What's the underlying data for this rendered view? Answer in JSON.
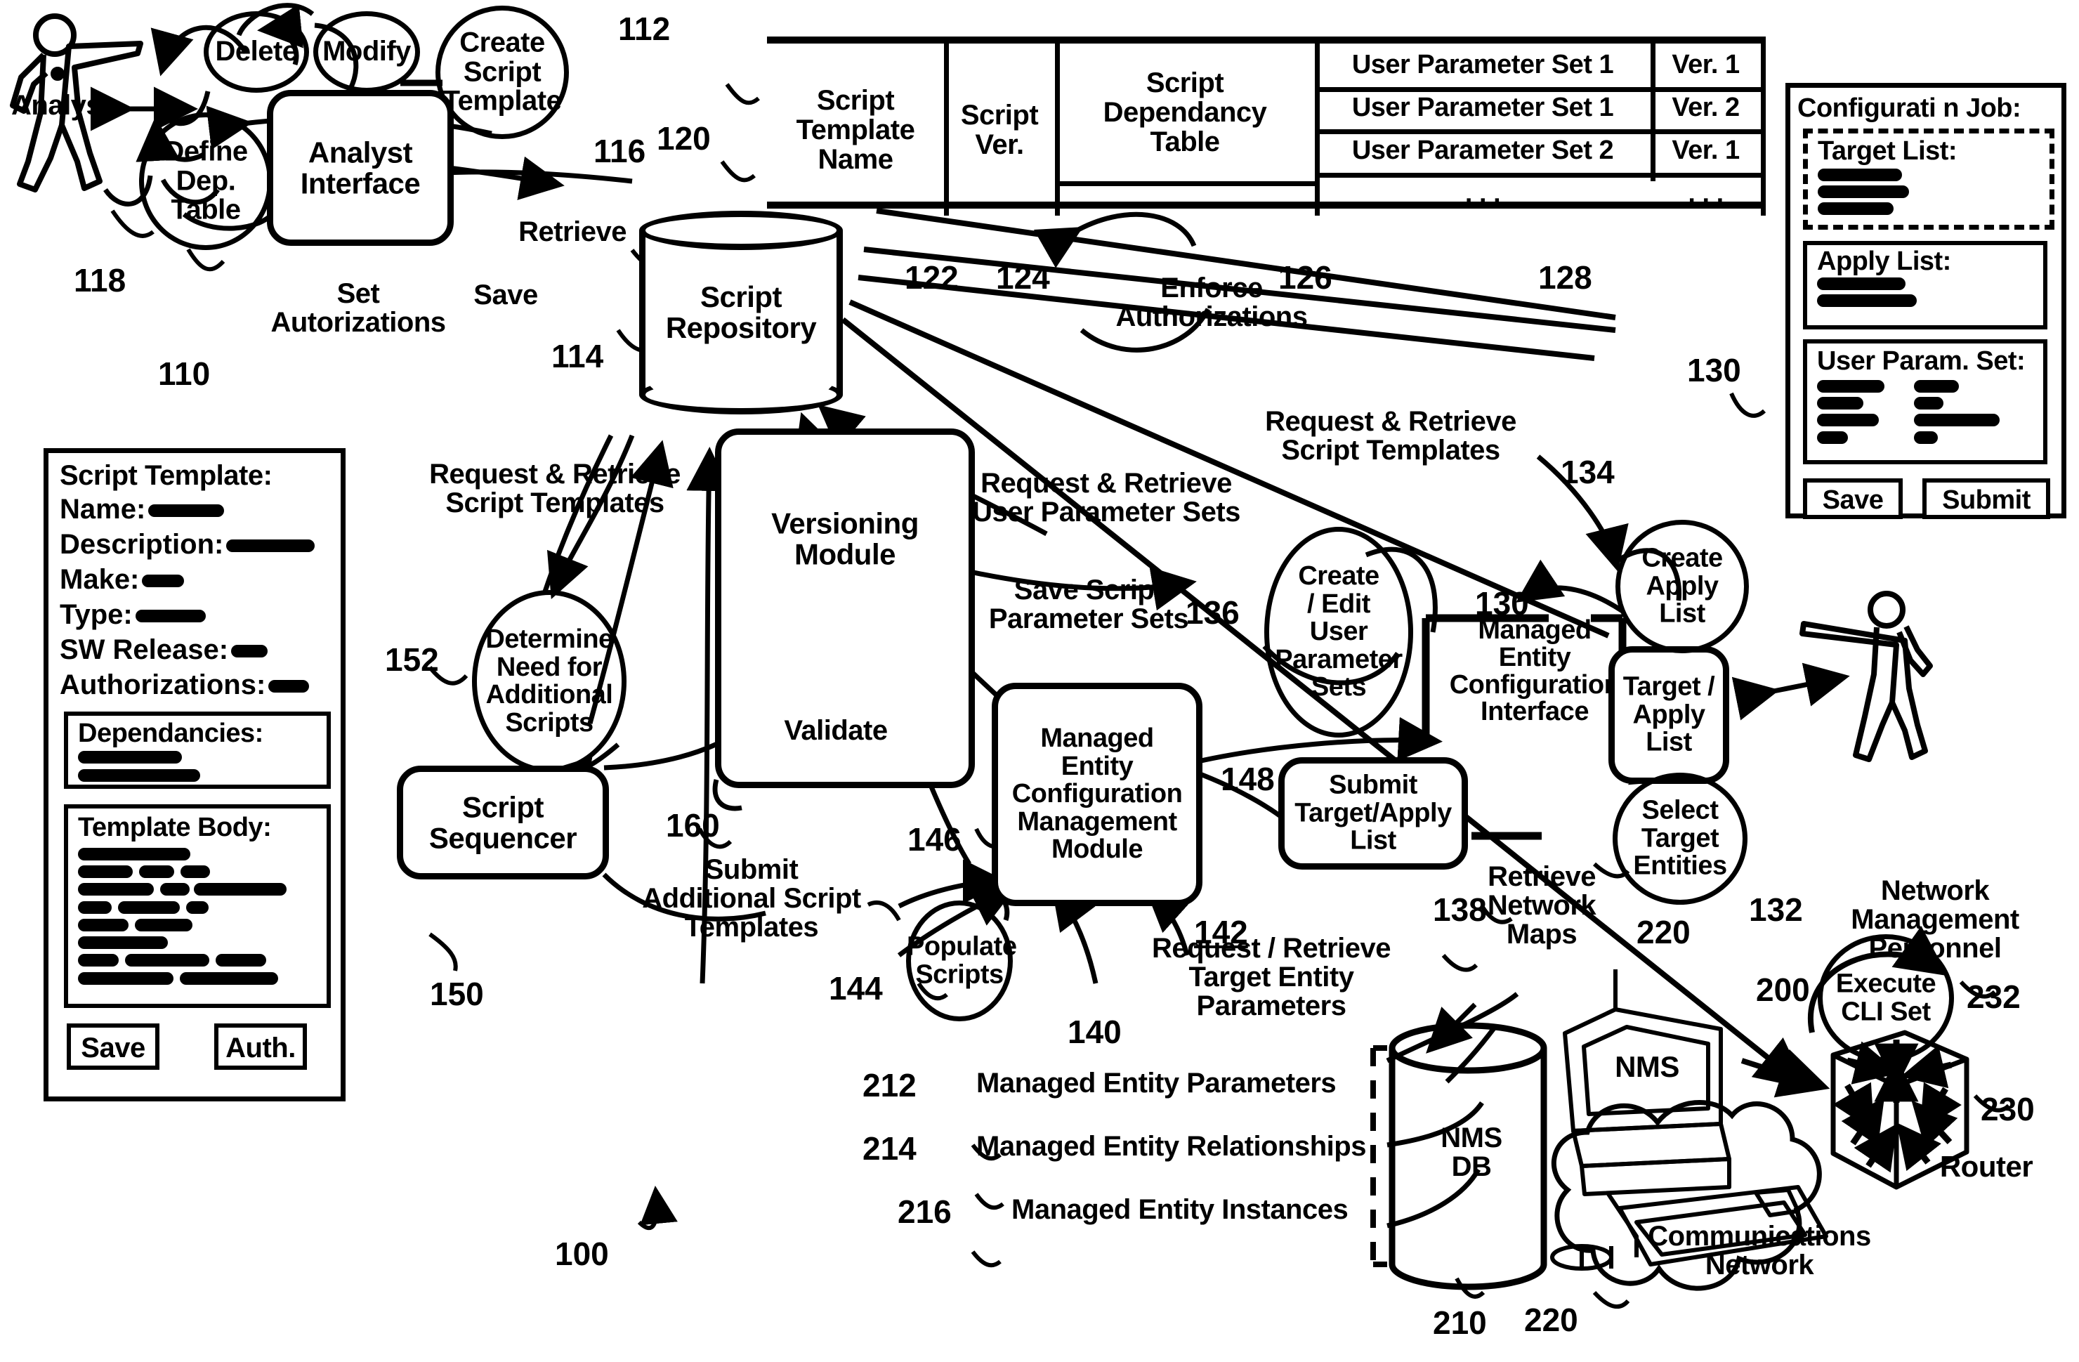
{
  "figure": {
    "ref_main": "100",
    "analyst_actor": "Analyst",
    "nm_personnel": "Network\nManagement\nPersonnel"
  },
  "analyst_side": {
    "interface_box": "Analyst\nInterface",
    "interface_ref": "110",
    "bubbles": [
      {
        "label": "Delete",
        "ref": ""
      },
      {
        "label": "Modify",
        "ref": ""
      },
      {
        "label": "Create\nScript\nTemplate",
        "ref": "112"
      },
      {
        "label": "Define\nDep.\nTable",
        "ref": "118"
      }
    ],
    "edge_labels": [
      {
        "label": "Retrieve",
        "ref": "116"
      },
      {
        "label": "Save",
        "ref": "114"
      },
      {
        "label": "Set\nAutorizations",
        "ref": ""
      }
    ]
  },
  "repository": {
    "label": "Script\nRepository",
    "ref": "120"
  },
  "table": {
    "headers": [
      "Script\nTemplate\nName",
      "Script\nVer.",
      "Script\nDependancy\nTable"
    ],
    "header_refs": [
      "122",
      "124",
      "126"
    ],
    "param_col_ref": "128",
    "rows": [
      [
        "User Parameter Set 1",
        "Ver. 1"
      ],
      [
        "User Parameter Set 1",
        "Ver. 2"
      ],
      [
        "User Parameter Set 2",
        "Ver. 1"
      ]
    ],
    "ellipsis": ". . ."
  },
  "script_template_panel": {
    "title": "Script Template:",
    "fields": [
      {
        "label": "Name:",
        "value_width": 108
      },
      {
        "label": "Description:",
        "value_width": 126
      },
      {
        "label": "Make:",
        "value_width": 60
      },
      {
        "label": "Type:",
        "value_width": 100
      },
      {
        "label": "SW Release:",
        "value_width": 52
      },
      {
        "label": "Authorizations:",
        "value_width": 58
      }
    ],
    "dependancies_title": "Dependancies:",
    "dependancies_lines": [
      [
        148
      ],
      [
        174
      ]
    ],
    "template_body_title": "Template Body:",
    "template_body_lines": [
      [
        160
      ],
      [
        78,
        50,
        42
      ],
      [
        108,
        42,
        132
      ],
      [
        48,
        88,
        32
      ],
      [
        72,
        82
      ],
      [
        128
      ],
      [
        58,
        120,
        72
      ],
      [
        136,
        140
      ]
    ],
    "buttons": [
      "Save",
      "Auth."
    ]
  },
  "config_job_panel": {
    "title": "Configurati  n Job:",
    "ref": "130",
    "target_list": {
      "title": "Target List:",
      "lines": [
        [
          120
        ],
        [
          130
        ],
        [
          108
        ]
      ]
    },
    "apply_list": {
      "title": "Apply List:",
      "lines": [
        [
          126
        ],
        [
          142
        ]
      ]
    },
    "user_param_set": {
      "title": "User Param. Set:",
      "rows": [
        [
          96,
          64
        ],
        [
          66,
          42
        ],
        [
          88,
          122
        ],
        [
          44,
          34
        ]
      ]
    },
    "buttons": [
      "Save",
      "Submit"
    ]
  },
  "flow_labels": [
    {
      "id": "enforce_auth",
      "text": "Enforce\nAuthorizations"
    },
    {
      "id": "req_ret_templates_top",
      "text": "Request & Retrieve\nScript Templates"
    },
    {
      "id": "req_ret_templates_left",
      "text": "Request & Retrieve\nScript Templates"
    },
    {
      "id": "req_ret_userparams",
      "text": "Request & Retrieve\nUser Parameter Sets"
    },
    {
      "id": "save_script_param_sets",
      "text": "Save Script\nParameter Sets"
    },
    {
      "id": "submit_additional",
      "text": "Submit\nAdditional Script\nTemplates"
    },
    {
      "id": "validate",
      "text": "Validate"
    },
    {
      "id": "retrieve_network_maps",
      "text": "Retrieve\nNetwork\nMaps"
    },
    {
      "id": "request_retrieve_target",
      "text": "Request / Retrieve\nTarget Entity\nParameters"
    }
  ],
  "modules": [
    {
      "id": "versioning_module",
      "label": "Versioning\nModule",
      "ref": "146"
    },
    {
      "id": "script_sequencer",
      "label": "Script\nSequencer",
      "ref": "150"
    },
    {
      "id": "mecm_module",
      "label": "Managed\nEntity\nConfiguration\nManagement\nModule",
      "ref": "142"
    },
    {
      "id": "mec_interface",
      "label": "Managed\nEntity\nConfiguration\nInterface",
      "ref": "130"
    },
    {
      "id": "submit_target_apply",
      "label": "Submit\nTarget/Apply\nList",
      "ref": "138"
    },
    {
      "id": "target_apply_list",
      "label": "Target /\nApply\nList",
      "ref": ""
    }
  ],
  "process_bubbles": [
    {
      "id": "determine_need",
      "label": "Determine\nNeed for\nAdditional\nScripts",
      "ref": "152"
    },
    {
      "id": "populate_scripts",
      "label": "Populate\nScripts",
      "ref": "144"
    },
    {
      "id": "create_edit_userparams",
      "label": "Create\n/ Edit\nUser\nParameter\nSets",
      "ref": "136"
    },
    {
      "id": "create_apply_list",
      "label": "Create\nApply\nList",
      "ref": "134"
    },
    {
      "id": "select_target_entities",
      "label": "Select\nTarget\nEntities",
      "ref": "132"
    },
    {
      "id": "execute_cli_set",
      "label": "Execute\nCLI Set",
      "ref": "232"
    }
  ],
  "other_refs": [
    {
      "id": "ref_148",
      "text": "148"
    },
    {
      "id": "ref_160",
      "text": "160"
    },
    {
      "id": "ref_140",
      "text": "140"
    },
    {
      "id": "ref_200",
      "text": "200"
    },
    {
      "id": "ref_210",
      "text": "210"
    },
    {
      "id": "ref_220_top",
      "text": "220"
    },
    {
      "id": "ref_220_bottom",
      "text": "220"
    },
    {
      "id": "ref_230",
      "text": "230"
    }
  ],
  "nms": {
    "screen_label": "NMS",
    "db_label": "NMS\nDB",
    "db_items": [
      {
        "ref": "212",
        "text": "Managed Entity Parameters"
      },
      {
        "ref": "214",
        "text": "Managed Entity Relationships"
      },
      {
        "ref": "216",
        "text": "Managed Entity Instances"
      }
    ],
    "network_label": "Communications\nNetwork",
    "router_label": "Router"
  }
}
